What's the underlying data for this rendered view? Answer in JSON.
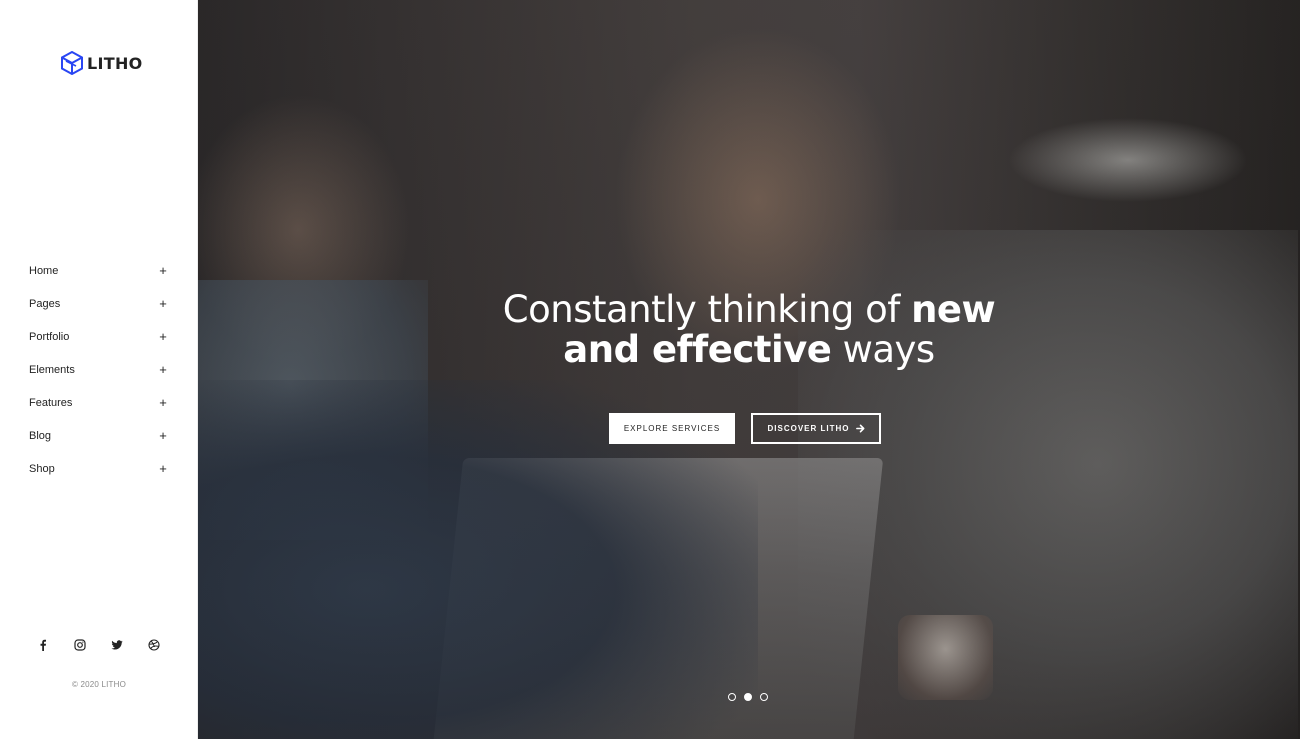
{
  "brand": {
    "name": "LITHO",
    "logo_icon": "hexagon-cube-icon",
    "accent_color": "#2946f3"
  },
  "menu": {
    "items": [
      {
        "label": "Home",
        "icon": "plus-icon"
      },
      {
        "label": "Pages",
        "icon": "plus-icon"
      },
      {
        "label": "Portfolio",
        "icon": "plus-icon"
      },
      {
        "label": "Elements",
        "icon": "plus-icon"
      },
      {
        "label": "Features",
        "icon": "plus-icon"
      },
      {
        "label": "Blog",
        "icon": "plus-icon"
      },
      {
        "label": "Shop",
        "icon": "plus-icon"
      }
    ],
    "expand_symbol": "+"
  },
  "social": {
    "links": [
      {
        "name": "facebook-icon"
      },
      {
        "name": "instagram-icon"
      },
      {
        "name": "twitter-icon"
      },
      {
        "name": "dribbble-icon"
      }
    ]
  },
  "footer": {
    "copyright": "© 2020 LITHO"
  },
  "hero": {
    "headline_line1_light": "Constantly thinking of ",
    "headline_line1_bold": "new",
    "headline_line2_bold": "and effective",
    "headline_line2_light": " ways",
    "primary_button": "Explore services",
    "secondary_button": "Discover litho",
    "secondary_button_icon": "arrow-right-icon",
    "slides_total": 3,
    "slide_active": 2
  }
}
